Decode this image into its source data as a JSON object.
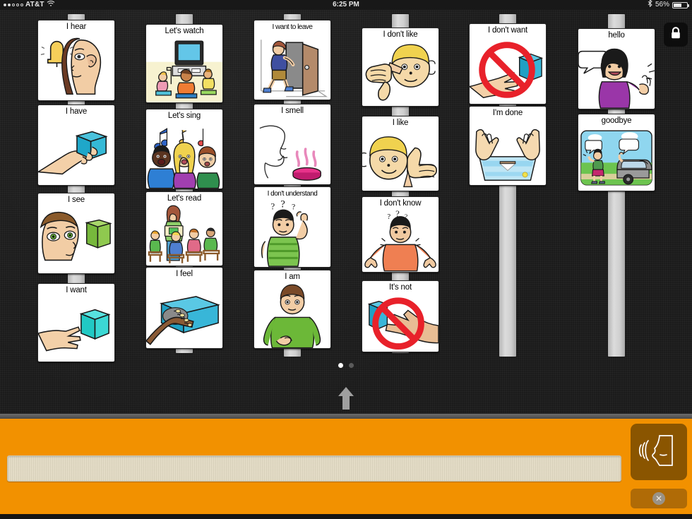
{
  "status_bar": {
    "carrier": "AT&T",
    "signal_dots_filled": 2,
    "signal_dots_total": 5,
    "wifi_icon": "wifi-icon",
    "time": "6:25 PM",
    "bluetooth_icon": "bluetooth-icon",
    "battery_percent": "56%",
    "battery_level": 56
  },
  "board": {
    "lock_icon": "lock-icon",
    "columns": [
      {
        "cards": [
          {
            "label": "I hear",
            "art": "bell-ear-face"
          },
          {
            "label": "I have",
            "art": "hand-holding-box"
          },
          {
            "label": "I see",
            "art": "face-eye-green-box"
          },
          {
            "label": "I want",
            "art": "open-hand-cyan-cube"
          }
        ]
      },
      {
        "cards": [
          {
            "label": "Let's watch",
            "art": "tv-children-watching"
          },
          {
            "label": "Let's sing",
            "art": "three-singers-music-notes"
          },
          {
            "label": "Let's read",
            "art": "teacher-reading-to-class"
          },
          {
            "label": "I feel",
            "art": "hand-touching-blue-box"
          }
        ]
      },
      {
        "cards": [
          {
            "label": "I want to leave",
            "art": "boy-walking-out-door"
          },
          {
            "label": "I smell",
            "art": "nose-profile-scent"
          },
          {
            "label": "I don't understand",
            "art": "boy-scratching-head-questions"
          },
          {
            "label": "I am",
            "art": "boy-pointing-at-self"
          }
        ]
      },
      {
        "cards": [
          {
            "label": "I don't like",
            "art": "thumbs-down-face"
          },
          {
            "label": "I like",
            "art": "thumbs-up-face"
          },
          {
            "label": "I don't know",
            "art": "boy-shrugging-questions"
          },
          {
            "label": "It's not",
            "art": "pointing-hand-box-prohibited"
          }
        ]
      },
      {
        "cards": [
          {
            "label": "I don't want",
            "art": "hand-reaching-cube-prohibited"
          },
          {
            "label": "I'm done",
            "art": "hands-over-tray"
          }
        ]
      },
      {
        "cards": [
          {
            "label": "hello",
            "art": "girl-waving-speech-bubble"
          },
          {
            "label": "goodbye",
            "art": "girl-waving-at-car"
          }
        ]
      }
    ],
    "pager": {
      "pages": 2,
      "active_page": 1
    },
    "scroll_arrow_icon": "up-arrow-icon"
  },
  "sentence_bar": {
    "strip_value": "",
    "speak_icon": "speaking-head-icon",
    "clear_icon": "clear-x-icon"
  }
}
